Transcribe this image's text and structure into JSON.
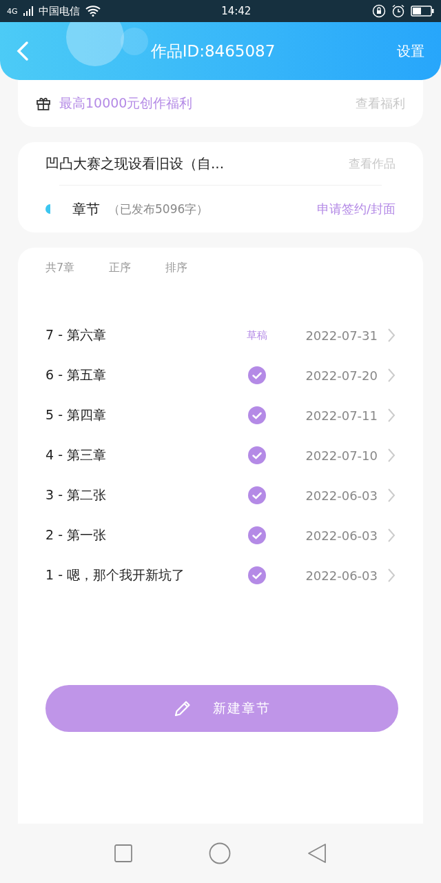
{
  "status_bar": {
    "network": "4G",
    "carrier": "中国电信",
    "time": "14:42"
  },
  "header": {
    "title": "作品ID:8465087",
    "settings": "设置"
  },
  "promo": {
    "text": "最高10000元创作福利",
    "link": "查看福利"
  },
  "work": {
    "title": "凹凸大赛之现设看旧设（自...",
    "view": "查看作品",
    "section": "章节",
    "stats": "（已发布5096字）",
    "apply": "申请签约/封面"
  },
  "toolbar": {
    "count": "共7章",
    "order": "正序",
    "sort": "排序"
  },
  "chapters": [
    {
      "title": "7 - 第六章",
      "kind": "draft",
      "badge": "草稿",
      "date": "2022-07-31"
    },
    {
      "title": "6 - 第五章",
      "kind": "published",
      "date": "2022-07-20"
    },
    {
      "title": "5 - 第四章",
      "kind": "published",
      "date": "2022-07-11"
    },
    {
      "title": "4 - 第三章",
      "kind": "published",
      "date": "2022-07-10"
    },
    {
      "title": "3 - 第二张",
      "kind": "published",
      "date": "2022-06-03"
    },
    {
      "title": "2 - 第一张",
      "kind": "published",
      "date": "2022-06-03"
    },
    {
      "title": "1 - 嗯，那个我开新坑了",
      "kind": "published",
      "date": "2022-06-03"
    }
  ],
  "new_button": "新建章节"
}
